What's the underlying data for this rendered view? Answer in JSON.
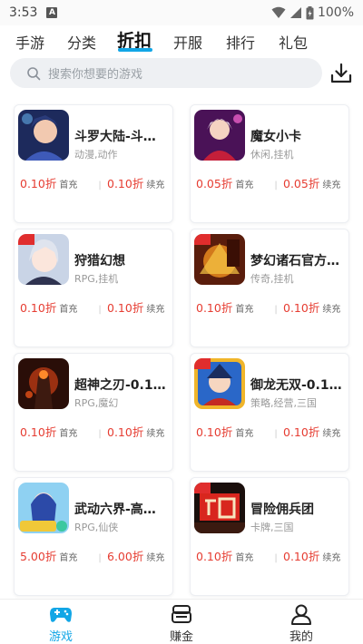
{
  "status_bar": {
    "time": "3:53",
    "battery": "100%"
  },
  "tabs": [
    {
      "label": "手游"
    },
    {
      "label": "分类"
    },
    {
      "label": "折扣"
    },
    {
      "label": "开服"
    },
    {
      "label": "排行"
    },
    {
      "label": "礼包"
    }
  ],
  "search": {
    "placeholder": "搜索你想要的游戏"
  },
  "games": [
    {
      "name": "斗罗大陆-斗…",
      "tags": "动漫,动作",
      "first_price": "0.10折",
      "first_label": "首充",
      "renew_price": "0.10折",
      "renew_label": "续充",
      "icon": "douluo-icon"
    },
    {
      "name": "魔女小卡",
      "tags": "休闲,挂机",
      "first_price": "0.05折",
      "first_label": "首充",
      "renew_price": "0.05折",
      "renew_label": "续充",
      "icon": "monv-icon"
    },
    {
      "name": "狩猎幻想",
      "tags": "RPG,挂机",
      "first_price": "0.10折",
      "first_label": "首充",
      "renew_price": "0.10折",
      "renew_label": "续充",
      "icon": "shoulie-icon"
    },
    {
      "name": "梦幻诸石官方…",
      "tags": "传奇,挂机",
      "first_price": "0.10折",
      "first_label": "首充",
      "renew_price": "0.10折",
      "renew_label": "续充",
      "icon": "menghuan-icon"
    },
    {
      "name": "超神之刃-0.1…",
      "tags": "RPG,魔幻",
      "first_price": "0.10折",
      "first_label": "首充",
      "renew_price": "0.10折",
      "renew_label": "续充",
      "icon": "chaoshen-icon"
    },
    {
      "name": "御龙无双-0.1…",
      "tags": "策略,经营,三国",
      "first_price": "0.10折",
      "first_label": "首充",
      "renew_price": "0.10折",
      "renew_label": "续充",
      "icon": "yulong-icon"
    },
    {
      "name": "武动六界-高…",
      "tags": "RPG,仙侠",
      "first_price": "5.00折",
      "first_label": "首充",
      "renew_price": "6.00折",
      "renew_label": "续充",
      "icon": "wudong-icon"
    },
    {
      "name": "冒险佣兵团",
      "tags": "卡牌,三国",
      "first_price": "0.10折",
      "first_label": "首充",
      "renew_price": "0.10折",
      "renew_label": "续充",
      "icon": "maoxian-icon"
    }
  ],
  "bottom_nav": [
    {
      "label": "游戏",
      "icon": "gamepad-icon",
      "active": true
    },
    {
      "label": "赚金",
      "icon": "coin-box-icon",
      "active": false
    },
    {
      "label": "我的",
      "icon": "user-icon",
      "active": false
    }
  ],
  "colors": {
    "accent": "#12a6e6",
    "price": "#e63d32"
  }
}
